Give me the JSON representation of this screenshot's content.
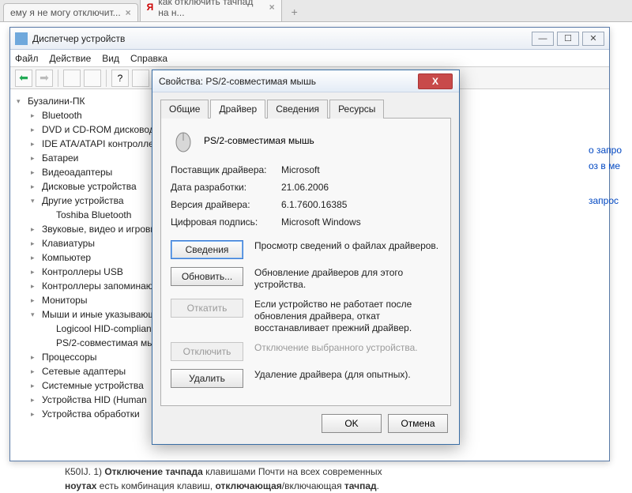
{
  "browser": {
    "tabs": [
      {
        "title": "ему я не могу отключит..."
      },
      {
        "title": "как отключить тачпад на н..."
      }
    ]
  },
  "dm": {
    "title": "Диспетчер устройств",
    "menu": [
      "Файл",
      "Действие",
      "Вид",
      "Справка"
    ],
    "root": "Бузалини-ПК",
    "items": [
      "Bluetooth",
      "DVD и CD-ROM дисководы",
      "IDE ATA/ATAPI контроллеры",
      "Батареи",
      "Видеоадаптеры",
      "Дисковые устройства",
      "Другие устройства",
      "Toshiba Bluetooth",
      "Звуковые, видео и игровые",
      "Клавиатуры",
      "Компьютер",
      "Контроллеры USB",
      "Контроллеры запоминающих",
      "Мониторы",
      "Мыши и иные указывающие",
      "Logicool HID-compliant",
      "PS/2-совместимая мышь",
      "Процессоры",
      "Сетевые адаптеры",
      "Системные устройства",
      "Устройства HID (Human",
      "Устройства обработки"
    ]
  },
  "dlg": {
    "title": "Свойства: PS/2-совместимая мышь",
    "tabs": [
      "Общие",
      "Драйвер",
      "Сведения",
      "Ресурсы"
    ],
    "device_name": "PS/2-совместимая мышь",
    "rows": {
      "vendor_l": "Поставщик драйвера:",
      "vendor_v": "Microsoft",
      "date_l": "Дата разработки:",
      "date_v": "21.06.2006",
      "ver_l": "Версия драйвера:",
      "ver_v": "6.1.7600.16385",
      "sig_l": "Цифровая подпись:",
      "sig_v": "Microsoft Windows"
    },
    "actions": {
      "details_b": "Сведения",
      "details_d": "Просмотр сведений о файлах драйверов.",
      "update_b": "Обновить...",
      "update_d": "Обновление драйверов для этого устройства.",
      "rollback_b": "Откатить",
      "rollback_d": "Если устройство не работает после обновления драйвера, откат восстанавливает прежний драйвер.",
      "disable_b": "Отключить",
      "disable_d": "Отключение выбранного устройства.",
      "delete_b": "Удалить",
      "delete_d": "Удаление драйвера (для опытных)."
    },
    "ok": "OK",
    "cancel": "Отмена"
  },
  "side": {
    "l1": "о запро",
    "l2": "оз в ме",
    "l3": "запрос"
  },
  "bottom": {
    "p1a": "К50IJ. 1) ",
    "p1b": "Отключение тачпада",
    "p1c": " клавишами Почти на всех современных",
    "p2a": "ноутах",
    "p2b": " есть комбинация клавиш, ",
    "p2c": "отключающая",
    "p2d": "/включающая ",
    "p2e": "тачпад",
    "p2f": "."
  }
}
